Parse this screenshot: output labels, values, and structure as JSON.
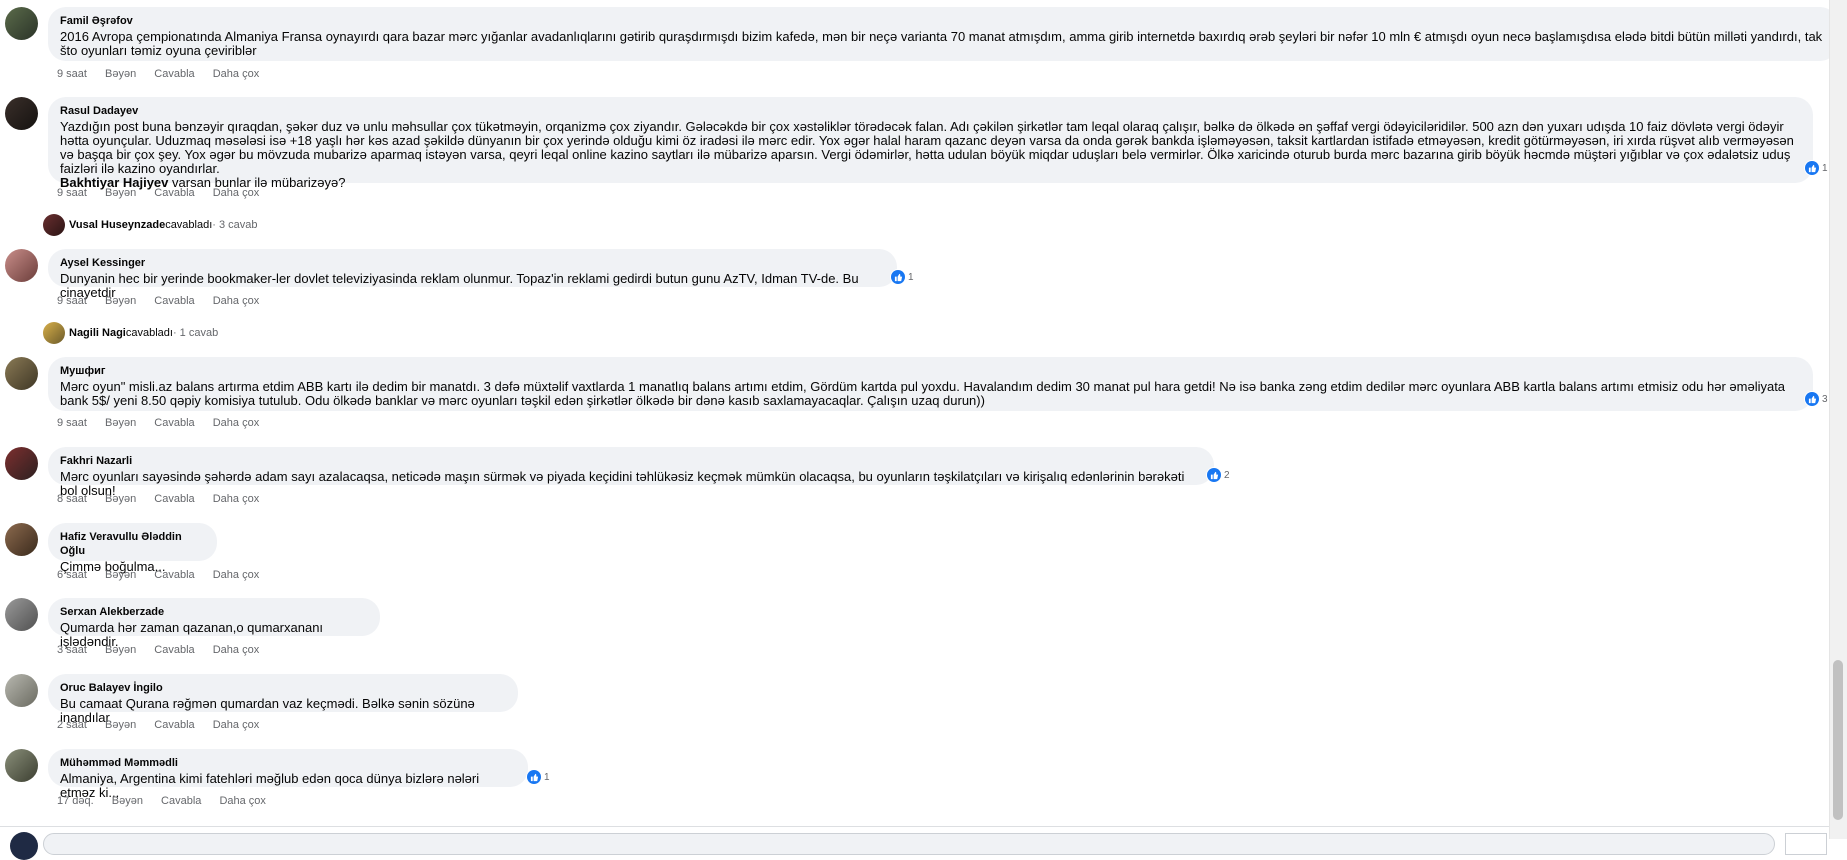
{
  "action_labels": {
    "like": "Bəyən",
    "reply": "Cavabla",
    "more": "Daha çox"
  },
  "comments": [
    {
      "author": "Famil Əşrəfov",
      "text": "2016 Avropa çempionatında Almaniya Fransa oynayırdı qara bazar mərc yığanlar avadanlıqlarını gətirib quraşdırmışdı bizim kafedə, mən bir neçə varianta 70 manat atmışdım, amma girib internetdə baxırdıq ərəb şeyləri bir nəfər 10 mln € atmışdı oyun necə başlamışdısa elədə bitdi bütün milləti yandırdı, tak što oyunları təmiz oyuna çeviriblər",
      "time": "9 saat"
    },
    {
      "author": "Rasul Dadayev",
      "text": "Yazdığın post buna bənzəyir qıraqdan, şəkər duz və unlu məhsullar çox tükətməyin, orqanizmə çox ziyandır. Gələcəkdə bir çox xəstəliklər törədəcək falan. Adı çəkilən şirkətlər tam leqal olaraq çalışır, bəlkə də ölkədə ən şəffaf vergi ödəyiciləridilər. 500 azn dən yuxarı udışda 10 faiz dövlətə vergi ödəyir hətta oyunçular. Uduzmaq məsələsi isə +18 yaşlı hər kəs azad şəkildə dünyanın bir çox yerində olduğu kimi öz iradəsi ilə mərc edir. Yox əgər halal haram qazanc deyən varsa da onda gərək bankda işləməyəsən, taksit kartlardan istifadə etməyəsən, kredit götürməyəsən, iri xırda rüşvət alıb verməyəsən və başqa bir çox şey. Yox əgər bu mövzuda mubarizə aparmaq istəyən varsa, qeyri leqal online kazino saytları ilə mübarizə aparsın. Vergi ödəmirlər, hətta udulan böyük miqdar uduşları belə vermirlər. Ölkə xaricində oturub burda mərc bazarına girib böyük həcmdə müştəri yığıblar və çox ədalətsiz uduş faizləri ilə kazino oyandırlar.",
      "mention": "Bakhtiyar Hajiyev",
      "mention_rest": " varsan bunlar ilə mübarizəyə?",
      "time": "9 saat",
      "reactions": "1"
    },
    {
      "author": "Aysel Kessinger",
      "text": "Dunyanin hec bir yerinde bookmaker-ler dovlet televiziyasinda reklam olunmur. Topaz'in reklami gedirdi butun gunu AzTV, Idman TV-de. Bu cinayetdir",
      "time": "9 saat",
      "reactions": "1"
    },
    {
      "author": "Мушфиг",
      "text": "Mərc oyun\" misli.az balans artırma etdim ABB kartı ilə dedim bir manatdı. 3 dəfə müxtəlif vaxtlarda 1 manatlıq balans artımı etdim, Gördüm kartda pul yoxdu. Havalandım dedim 30 manat pul hara getdi! Nə isə banka zəng etdim dedilər mərc oyunlara ABB kartla balans artımı etmisiz odu hər əməliyata bank 5$/ yeni 8.50 qəpiy komisiya tutulub. Odu ölkədə banklar və mərc oyunları təşkil edən şirkətlər ölkədə bir dənə kasıb saxlamayacaqlar. Çalışın uzaq durun))",
      "time": "9 saat",
      "reactions": "3"
    },
    {
      "author": "Fakhri Nazarli",
      "text": "Mərc oyunları sayəsində şəhərdə adam sayı azalacaqsa, neticədə maşın sürmək və piyada keçidini təhlükəsiz keçmək mümkün olacaqsa, bu oyunların təşkilatçıları və kirişalıq edənlərinin bərəkəti bol olsun!",
      "time": "8 saat",
      "reactions": "2"
    },
    {
      "author": "Hafiz Veravullu Ələddin Oğlu",
      "text": "Çimmə boğulma...",
      "time": "6 saat"
    },
    {
      "author": "Serxan Alekberzade",
      "text": "Qumarda hər zaman qazanan,o qumarxananı işlədəndir.",
      "time": "3 saat"
    },
    {
      "author": "Oruc Balayev İngilo",
      "text": "Bu camaat Qurana rəğmən qumardan vaz keçmədi. Bəlkə sənin sözünə inandılar",
      "time": "2 saat"
    },
    {
      "author": "Mühəmməd Məmmədli",
      "text": "Almaniya, Argentina kimi fatehləri məğlub edən qoca dünya bizlərə nələri etməz ki...",
      "time": "17 dəq.",
      "reactions": "1"
    }
  ],
  "replies": [
    {
      "name": "Vusal Huseynzade",
      "verb": " cavabladı",
      "count": " · 3 cavab"
    },
    {
      "name": "Nagili Nagi",
      "verb": " cavabladı",
      "count": " · 1 cavab"
    }
  ],
  "colors": {
    "bubble": "#f0f2f5",
    "like": "#1877f2",
    "muted": "#65676b"
  }
}
